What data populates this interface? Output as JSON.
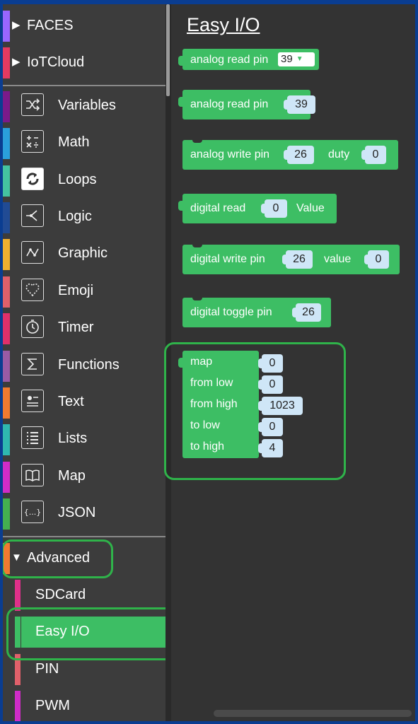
{
  "sidebar": {
    "top_categories": [
      {
        "label": "FACES",
        "color": "#9966ff"
      },
      {
        "label": "IoTCloud",
        "color": "#e23a61"
      }
    ],
    "categories": [
      {
        "label": "Variables",
        "color": "#7a1a8a",
        "icon": "shuffle-icon"
      },
      {
        "label": "Math",
        "color": "#2a9fdc",
        "icon": "calculator-icon"
      },
      {
        "label": "Loops",
        "color": "#45c2a0",
        "icon": "loop-icon"
      },
      {
        "label": "Logic",
        "color": "#214b94",
        "icon": "branch-icon"
      },
      {
        "label": "Graphic",
        "color": "#f0b030",
        "icon": "graphic-icon"
      },
      {
        "label": "Emoji",
        "color": "#e0606a",
        "icon": "heart-icon"
      },
      {
        "label": "Timer",
        "color": "#e0306a",
        "icon": "clock-icon"
      },
      {
        "label": "Functions",
        "color": "#995ba5",
        "icon": "sigma-icon"
      },
      {
        "label": "Text",
        "color": "#f07a30",
        "icon": "text-card-icon"
      },
      {
        "label": "Lists",
        "color": "#2fb8b0",
        "icon": "list-icon"
      },
      {
        "label": "Map",
        "color": "#d02cc8",
        "icon": "book-icon"
      },
      {
        "label": "JSON",
        "color": "#44b050",
        "icon": "json-braces-icon"
      }
    ],
    "advanced": {
      "label": "Advanced",
      "color": "#f07a30"
    },
    "subcategories": [
      {
        "label": "SDCard",
        "color": "#e0308a"
      },
      {
        "label": "Easy I/O",
        "color": "#3dbe64",
        "selected": true
      },
      {
        "label": "PIN",
        "color": "#e0606a"
      },
      {
        "label": "PWM",
        "color": "#d02cc8"
      }
    ]
  },
  "workspace": {
    "title": "Easy I/O",
    "blocks": {
      "analog_read_dropdown": {
        "label": "analog read pin",
        "value": "39"
      },
      "analog_read": {
        "label": "analog read pin",
        "value": "39"
      },
      "analog_write": {
        "label": "analog write pin",
        "pin": "26",
        "duty_label": "duty",
        "duty": "0"
      },
      "digital_read": {
        "label": "digital read",
        "value": "0",
        "suffix": "Value"
      },
      "digital_write": {
        "label": "digital write pin",
        "pin": "26",
        "value_label": "value",
        "value": "0"
      },
      "digital_toggle": {
        "label": "digital toggle pin",
        "pin": "26"
      },
      "map": {
        "rows": [
          {
            "label": "map",
            "value": "0"
          },
          {
            "label": "from low",
            "value": "0"
          },
          {
            "label": "from high",
            "value": "1023"
          },
          {
            "label": "to low",
            "value": "0"
          },
          {
            "label": "to high",
            "value": "4"
          }
        ]
      }
    }
  },
  "colors": {
    "block_green": "#3dbe64",
    "highlight_outline": "#2fb34a"
  }
}
